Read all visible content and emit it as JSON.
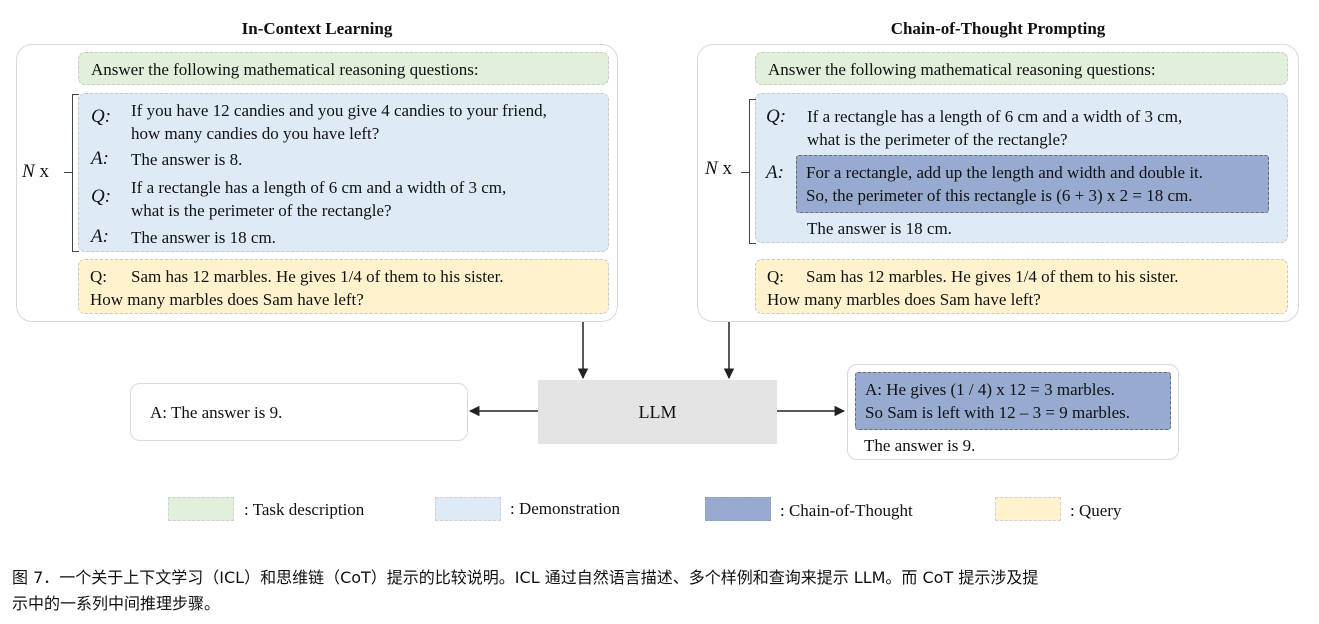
{
  "icl": {
    "title": "In-Context Learning",
    "task": "Answer the following mathematical reasoning questions:",
    "nx_n": "N",
    "nx_x": "x",
    "demos": [
      {
        "q_label": "Q:",
        "q_lines": [
          "If you have 12 candies and you give 4 candies to your friend,",
          "how many candies do you have left?"
        ],
        "a_label": "A:",
        "a": "The answer is 8."
      },
      {
        "q_label": "Q:",
        "q_lines": [
          "If a rectangle has a length of 6 cm and a width of 3 cm,",
          "what is the perimeter of the rectangle?"
        ],
        "a_label": "A:",
        "a": "The answer is 18 cm."
      }
    ],
    "query_label": "Q:",
    "query_lines": [
      "Sam has 12 marbles. He gives 1/4 of them to his sister.",
      "How many marbles does Sam have left?"
    ],
    "output": "A: The answer is 9."
  },
  "cot": {
    "title": "Chain-of-Thought Prompting",
    "task": "Answer the following mathematical reasoning questions:",
    "nx_n": "N",
    "nx_x": "x",
    "q_label": "Q:",
    "q_lines": [
      "If a rectangle has a length of 6 cm and a width of 3 cm,",
      "what is the perimeter of the rectangle?"
    ],
    "a_label": "A:",
    "reasoning_lines": [
      "For a rectangle, add up the length and width and double it.",
      "So, the perimeter of this rectangle is (6 + 3) x 2 = 18 cm."
    ],
    "answer": "The answer is 18 cm.",
    "query_label": "Q:",
    "query_lines": [
      "Sam has 12 marbles. He gives 1/4 of them to his sister.",
      "How many marbles does Sam have left?"
    ],
    "output_reasoning_lines": [
      "A: He gives (1 / 4) x 12 = 3 marbles.",
      "So Sam is left with 12 – 3 = 9 marbles."
    ],
    "output_answer": "The answer is 9."
  },
  "llm_label": "LLM",
  "legend": [
    {
      "label": ": Task description",
      "color": "#e2efda"
    },
    {
      "label": ": Demonstration",
      "color": "#deebf7"
    },
    {
      "label": ": Chain-of-Thought",
      "color": "#97abd1"
    },
    {
      "label": ": Query",
      "color": "#fff2cc"
    }
  ],
  "caption_lines": [
    "图 7．一个关于上下文学习（ICL）和思维链（CoT）提示的比较说明。ICL 通过自然语言描述、多个样例和查询来提示 LLM。而 CoT 提示涉及提",
    "示中的一系列中间推理步骤。"
  ]
}
